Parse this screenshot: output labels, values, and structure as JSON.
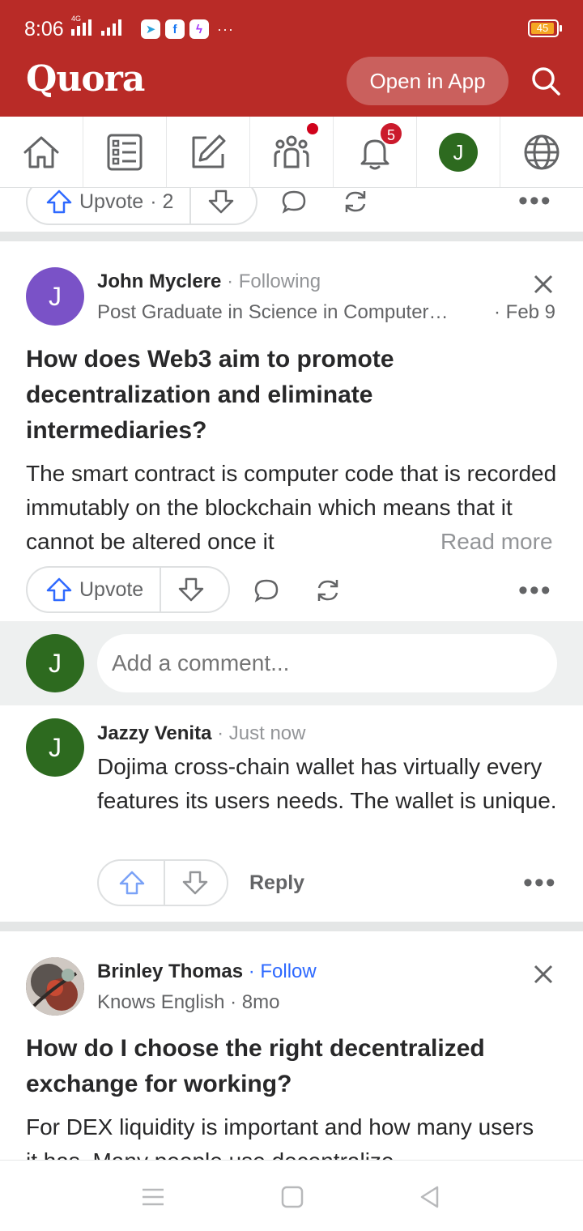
{
  "status_bar": {
    "time": "8:06",
    "network": "4G",
    "battery": "45"
  },
  "header": {
    "logo": "Quora",
    "open_app_label": "Open in App"
  },
  "nav": {
    "tabs": [
      "home",
      "following",
      "answer",
      "spaces",
      "notifications",
      "profile",
      "languages"
    ],
    "notifications_count": "5",
    "profile_initial": "J"
  },
  "prev_post": {
    "upvote_label": "Upvote",
    "upvote_count": "· 2"
  },
  "post1": {
    "author": "John Myclere",
    "relation": "· Following",
    "credential": "Post Graduate in Science in Computer…",
    "date": "· Feb 9",
    "title": "How does Web3 aim to promote decentralization and eliminate intermediaries?",
    "snippet": "The smart contract is computer code that is recorded immutably on the blockchain which means that it cannot be altered once it",
    "read_more": "Read more",
    "upvote_label": "Upvote",
    "avatar_initial": "J",
    "avatar_color": "#7a52c7"
  },
  "comment_box": {
    "avatar_initial": "J",
    "placeholder": "Add a comment..."
  },
  "comment": {
    "author": "Jazzy Venita",
    "time": "· Just now",
    "text": "Dojima cross-chain wallet has virtually every features its users needs. The wallet is unique.",
    "reply_label": "Reply",
    "avatar_initial": "J"
  },
  "post2": {
    "author": "Brinley Thomas",
    "relation": "· Follow",
    "credential": "Knows English · 8mo",
    "title": "How do I choose the right decentralized exchange for working?",
    "snippet": "For DEX liquidity is important and how many users it has. Many people use decentralize"
  },
  "colors": {
    "brand": "#b92b27",
    "link": "#2e69ff",
    "avatar_green": "#2d6a1f"
  }
}
